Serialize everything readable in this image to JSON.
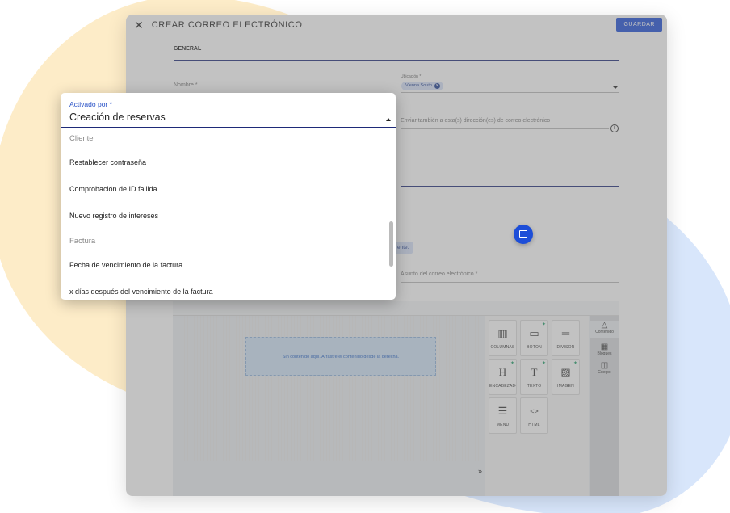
{
  "header": {
    "title": "CREAR CORREO ELECTRÓNICO",
    "save_label": "GUARDAR"
  },
  "form": {
    "section_title": "GENERAL",
    "name_placeholder": "Nombre *",
    "location_label": "Ubicación *",
    "location_chip": "Vienna South",
    "cc_placeholder": "Enviar también a esta(s) dirección(es) de correo electrónico",
    "notice_fragment": "ente.",
    "subject_placeholder": "Asunto del correo electrónico *"
  },
  "editor": {
    "empty_message": "Sin contenido aquí. Arrastre el contenido desde la derecha.",
    "tools": [
      {
        "label": "COLUMNAS",
        "icon": "columns-icon"
      },
      {
        "label": "BOTÓN",
        "icon": "button-icon"
      },
      {
        "label": "DIVISOR",
        "icon": "divider-icon"
      },
      {
        "label": "ENCABEZADO",
        "icon": "heading-icon"
      },
      {
        "label": "TEXTO",
        "icon": "text-icon"
      },
      {
        "label": "IMAGEN",
        "icon": "image-icon"
      },
      {
        "label": "MENÚ",
        "icon": "menu-icon"
      },
      {
        "label": "HTML",
        "icon": "html-icon"
      }
    ],
    "rail": [
      {
        "label": "Contenido",
        "icon": "shapes-icon"
      },
      {
        "label": "Bloques",
        "icon": "blocks-icon"
      },
      {
        "label": "Cuerpo",
        "icon": "body-layout-icon"
      }
    ]
  },
  "dropdown": {
    "label": "Activado por *",
    "value": "Creación de reservas",
    "groups": [
      {
        "name": "Cliente",
        "options": [
          "Restablecer contraseña",
          "Comprobación de ID fallida",
          "Nuevo registro de intereses"
        ]
      },
      {
        "name": "Factura",
        "options": [
          "Fecha de vencimiento de la factura",
          "x días después del vencimiento de la factura"
        ]
      }
    ]
  },
  "colors": {
    "accent": "#1d4ed8",
    "navy": "#1e2a78",
    "chip_bg": "#d6e1f7"
  }
}
